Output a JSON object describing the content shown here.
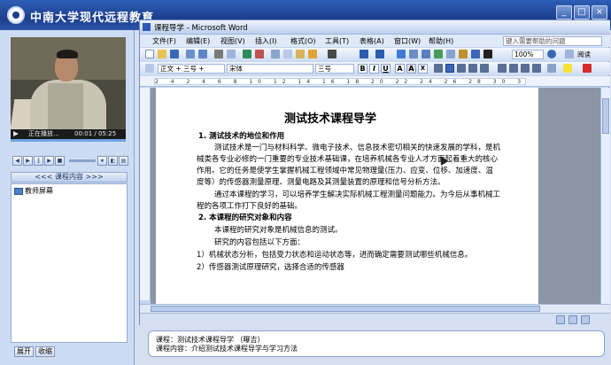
{
  "app": {
    "banner_title": "中南大学现代远程教育",
    "window_buttons": [
      "_",
      "□",
      "×"
    ]
  },
  "player": {
    "status": "正在播放...",
    "time": "00:01 / 05:25",
    "progress": 0.003
  },
  "sidebar": {
    "course_header": "<<< 课程内容 >>>",
    "tree_items": [
      "教师屏幕"
    ],
    "expand_label": "展开",
    "collapse_label": "收缩"
  },
  "word": {
    "window_title": "课程导学 - Microsoft Word",
    "menu": [
      "文件(F)",
      "编辑(E)",
      "视图(V)",
      "插入(I)",
      "格式(O)",
      "工具(T)",
      "表格(A)",
      "窗口(W)",
      "帮助(H)"
    ],
    "help_placeholder": "键入需要帮助的问题",
    "zoom": "100%",
    "read_label": "阅读",
    "style": "正文 + 三号 +",
    "font": "宋体",
    "size": "三号",
    "ruler": "2 4 2 4 6 8 10 12 14 16 18 20 22 24 26 28 30 32 34 36 38 40 42 44 46"
  },
  "document": {
    "title": "测试技术课程导学",
    "lines": [
      {
        "text": "1.  测试技术的地位和作用",
        "bold": true
      },
      {
        "text": "测试技术是一门与材料科学、微电子技术、信息技术密切相关的快速发展的学科，是机",
        "indent": true
      },
      {
        "text": "械类各专业必修的一门重要的专业技术基础课，在培养机械各专业人才方面起着重大的核心"
      },
      {
        "text": "作用。它的任务是使学生掌握机械工程领域中常见物理量(压力、应变、位移、加速度、温"
      },
      {
        "text": "度等）的传感器测量原理、测量电路及其测量装置的原理和信号分析方法。"
      },
      {
        "text": "通过本课程的学习，可以培养学生解决实际机械工程测量问题能力。为今后从事机械工",
        "indent": true
      },
      {
        "text": "程的各项工作打下良好的基础。"
      },
      {
        "text": "2.  本课程的研究对象和内容",
        "bold": true
      },
      {
        "text": "本课程的研究对象是机械信息的测试。",
        "indent": true
      },
      {
        "text": "研究的内容包括以下方面：",
        "indent": true
      },
      {
        "text": "1）机械状态分析，包括受力状态和运动状态等，进而确定需要测试哪些机械信息。"
      },
      {
        "text": "2）传感器测试原理研究，选择合适的传感器"
      }
    ]
  },
  "info": {
    "course": "课程：测试技术课程导学 （曝吉）",
    "content": "课程内容：介绍测试技术课程导学与学习方法"
  },
  "colors": {
    "banner": "#1c3f8c",
    "panel": "#cddcf2",
    "word_frame": "#c3d5f0"
  }
}
